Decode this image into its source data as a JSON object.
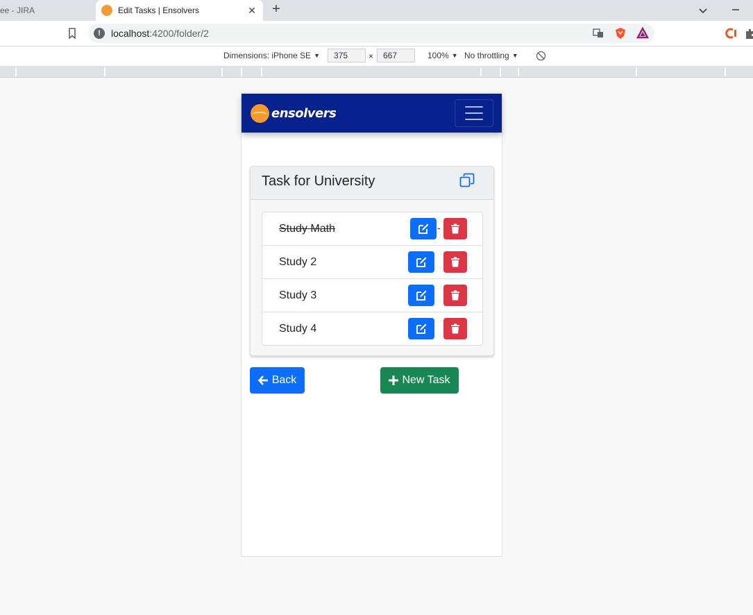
{
  "browser": {
    "inactive_tab_title": "ee - JIRA",
    "active_tab_title": "Edit Tasks | Ensolvers",
    "tab_close_glyph": "✕",
    "new_tab_glyph": "+",
    "url_host": "localhost",
    "url_rest": ":4200/folder/2"
  },
  "devtools": {
    "dimensions_label": "Dimensions: iPhone SE",
    "width": "375",
    "times": "×",
    "height": "667",
    "zoom": "100%",
    "throttling": "No throttling"
  },
  "app": {
    "brand": "ensolvers",
    "card_title": "Task for University",
    "tasks": [
      {
        "label": "Study Math",
        "done": true
      },
      {
        "label": "Study 2",
        "done": false
      },
      {
        "label": "Study 3",
        "done": false
      },
      {
        "label": "Study 4",
        "done": false
      }
    ],
    "dash": "-",
    "back_label": "Back",
    "new_task_label": "New Task"
  },
  "colors": {
    "navbar": "#08228d",
    "primary": "#0d6efd",
    "danger": "#dc3545",
    "success": "#198754",
    "logo": "#f49a2e"
  }
}
